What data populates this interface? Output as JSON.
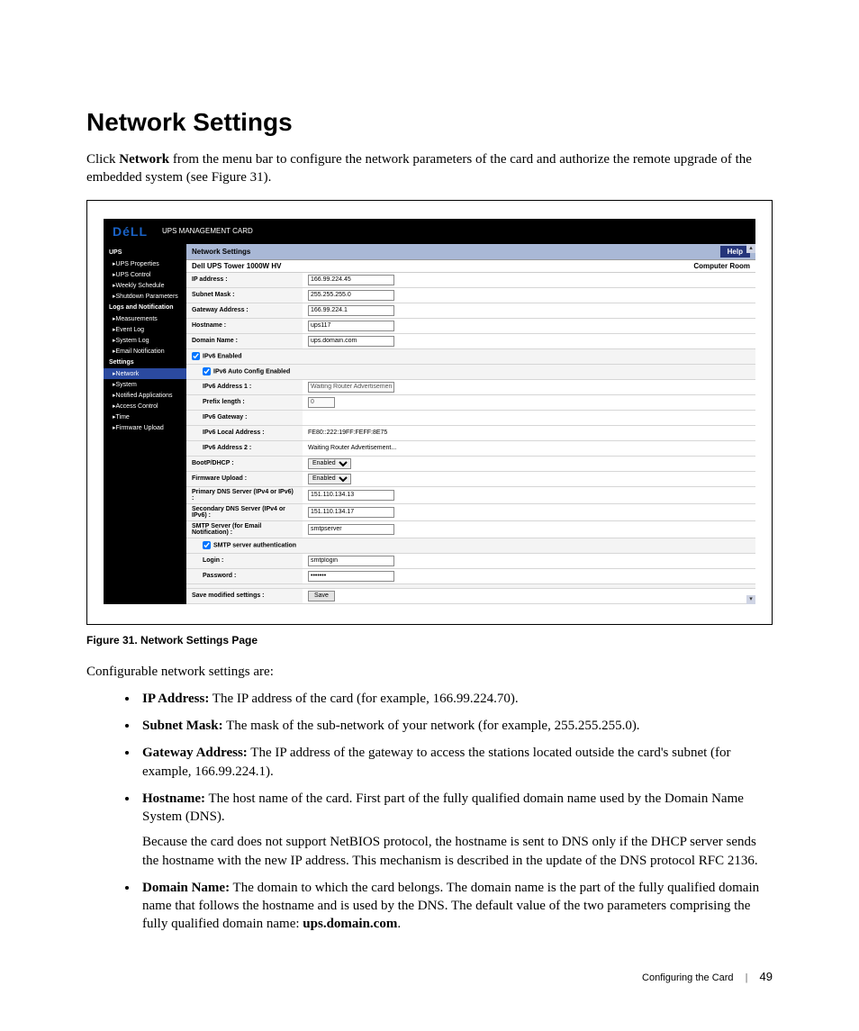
{
  "page": {
    "title": "Network Settings",
    "intro_pre": "Click ",
    "intro_bold": "Network",
    "intro_post": " from the menu bar to configure the network parameters of the card and authorize the remote upgrade of the embedded system (see Figure 31).",
    "caption": "Figure 31. Network Settings Page",
    "config_lead": "Configurable network settings are:",
    "footer_section": "Configuring the Card",
    "footer_page": "49"
  },
  "card": {
    "logo": "DéLL",
    "title": "UPS MANAGEMENT CARD",
    "panel_title": "Network Settings",
    "help": "Help",
    "device": "Dell UPS Tower 1000W HV",
    "location": "Computer Room",
    "sidebar": {
      "sections": [
        {
          "label": "UPS",
          "items": [
            "UPS Properties",
            "UPS Control",
            "Weekly Schedule",
            "Shutdown Parameters"
          ]
        },
        {
          "label": "Logs and Notification",
          "items": [
            "Measurements",
            "Event Log",
            "System Log",
            "Email Notification"
          ]
        },
        {
          "label": "Settings",
          "items": [
            "Network",
            "System",
            "Notified Applications",
            "Access Control",
            "Time",
            "Firmware Upload"
          ]
        }
      ],
      "selected": "Network"
    },
    "rows": {
      "ip_address": {
        "label": "IP address :",
        "value": "166.99.224.45"
      },
      "subnet_mask": {
        "label": "Subnet Mask :",
        "value": "255.255.255.0"
      },
      "gateway": {
        "label": "Gateway Address :",
        "value": "166.99.224.1"
      },
      "hostname": {
        "label": "Hostname :",
        "value": "ups117"
      },
      "domain_name": {
        "label": "Domain Name :",
        "value": "ups.domain.com"
      },
      "ipv6_enabled": {
        "label": "IPv6 Enabled"
      },
      "ipv6_autoconf": {
        "label": "IPv6 Auto Config Enabled"
      },
      "ipv6_addr1": {
        "label": "IPv6 Address 1 :",
        "value": "Waiting Router Advertisement ..."
      },
      "prefix_len": {
        "label": "Prefix length :",
        "value": "0"
      },
      "ipv6_gw": {
        "label": "IPv6 Gateway :",
        "value": ""
      },
      "ipv6_local": {
        "label": "IPv6 Local Address :",
        "value": "FE80::222:19FF:FEFF:8E75"
      },
      "ipv6_addr2": {
        "label": "IPv6 Address 2 :",
        "value": "Waiting Router Advertisement..."
      },
      "bootp": {
        "label": "BootP/DHCP :",
        "value": "Enabled"
      },
      "fw_upload": {
        "label": "Firmware Upload :",
        "value": "Enabled"
      },
      "dns1": {
        "label": "Primary DNS Server (IPv4 or IPv6) :",
        "value": "151.110.134.13"
      },
      "dns2": {
        "label": "Secondary DNS Server (IPv4 or IPv6) :",
        "value": "151.110.134.17"
      },
      "smtp": {
        "label": "SMTP Server (for Email Notification) :",
        "value": "smtpserver"
      },
      "smtp_auth": {
        "label": "SMTP server authentication"
      },
      "login": {
        "label": "Login :",
        "value": "smtplogin"
      },
      "password": {
        "label": "Password :",
        "value": "•••••••"
      },
      "save_row": {
        "label": "Save modified settings :",
        "button": "Save"
      }
    }
  },
  "defs": [
    {
      "term": "IP Address:",
      "text": " The IP address of the card (for example, 166.99.224.70)."
    },
    {
      "term": "Subnet Mask:",
      "text": " The mask of the sub-network of your network (for example, 255.255.255.0)."
    },
    {
      "term": "Gateway Address:",
      "text": " The IP address of the gateway to access the stations located outside the card's subnet (for example, 166.99.224.1)."
    },
    {
      "term": "Hostname:",
      "text": " The host name of the card. First part of the fully qualified domain name used by the Domain Name System (DNS).",
      "para": "Because the card does not support NetBIOS protocol, the hostname is sent to DNS only if the DHCP server sends the hostname with the new IP address. This mechanism is described in the update of the DNS protocol RFC 2136."
    },
    {
      "term": "Domain Name:",
      "text": " The domain to which the card belongs. The domain name is the part of the fully qualified domain name that follows the hostname and is used by the DNS. The default value of the two parameters comprising the fully qualified domain name: ",
      "tail_bold": "ups.domain.com",
      "tail": "."
    }
  ]
}
